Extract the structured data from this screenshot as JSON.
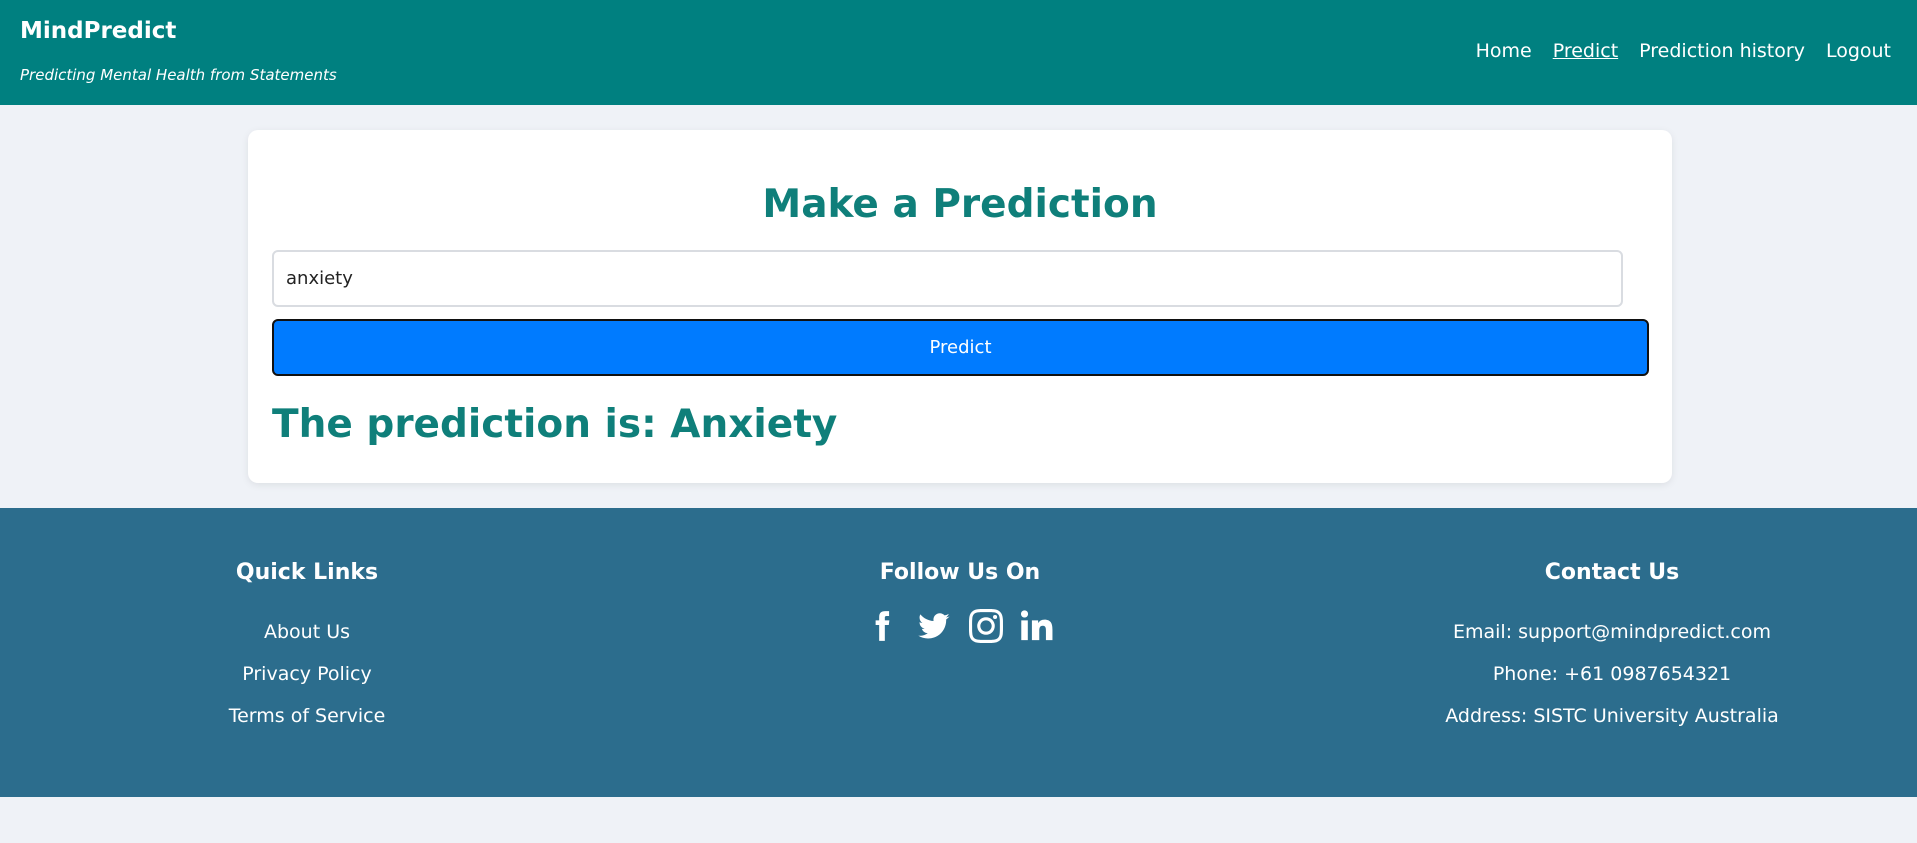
{
  "header": {
    "brand": "MindPredict",
    "tagline": "Predicting Mental Health from Statements",
    "nav": [
      {
        "label": "Home"
      },
      {
        "label": "Predict",
        "active": true
      },
      {
        "label": "Prediction history"
      },
      {
        "label": "Logout"
      }
    ]
  },
  "main": {
    "title": "Make a Prediction",
    "input_value": "anxiety",
    "predict_label": "Predict",
    "result": "The prediction is: Anxiety"
  },
  "footer": {
    "quick_links": {
      "title": "Quick Links",
      "items": [
        "About Us",
        "Privacy Policy",
        "Terms of Service"
      ]
    },
    "follow": {
      "title": "Follow Us On",
      "icons": [
        "facebook-icon",
        "twitter-icon",
        "instagram-icon",
        "linkedin-icon"
      ]
    },
    "contact": {
      "title": "Contact Us",
      "email": "Email: support@mindpredict.com",
      "phone": "Phone: +61 0987654321",
      "address": "Address: SISTC University Australia"
    }
  },
  "colors": {
    "header_bg": "#008080",
    "footer_bg": "#2c6d8d",
    "accent_text": "#0f7f7a",
    "button_bg": "#007bff",
    "page_bg": "#eff2f7"
  }
}
